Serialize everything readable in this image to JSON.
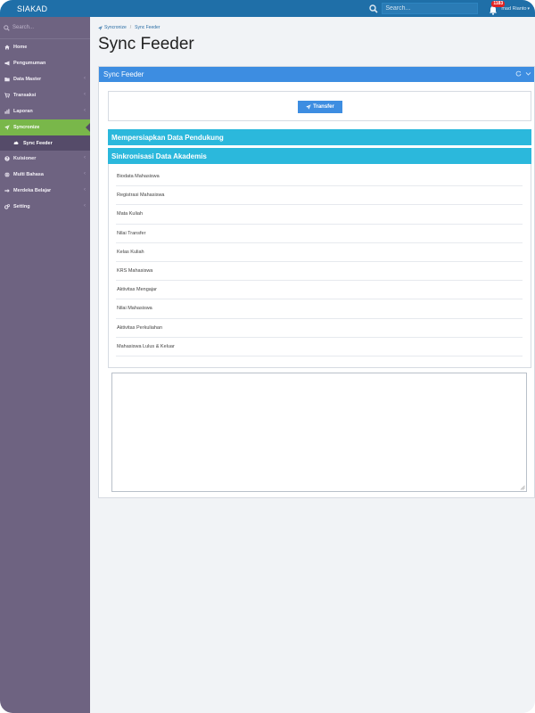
{
  "app": {
    "brand": "SIAKAD"
  },
  "topbar": {
    "search_placeholder": "Search...",
    "notification_count": "1183",
    "user_name": "mad Rianto"
  },
  "sidebar": {
    "search_text": "Search... ",
    "items": [
      {
        "label": "Home",
        "icon": "home-icon"
      },
      {
        "label": "Pengumuman",
        "icon": "bullhorn-icon"
      },
      {
        "label": "Data Master",
        "icon": "folder-icon"
      },
      {
        "label": "Transaksi",
        "icon": "cart-icon"
      },
      {
        "label": "Laporan",
        "icon": "bar-chart-icon"
      },
      {
        "label": "Syncronize",
        "icon": "paper-plane-icon"
      },
      {
        "label": "Kuisioner",
        "icon": "question-icon"
      },
      {
        "label": "Multi Bahasa",
        "icon": "globe-icon"
      },
      {
        "label": "Merdeka Belajar",
        "icon": "arrow-right-icon"
      },
      {
        "label": "Setting",
        "icon": "gears-icon"
      }
    ],
    "subitems": [
      {
        "label": "Sync Feeder",
        "icon": "cloud-icon"
      }
    ]
  },
  "breadcrumb": {
    "root": "Syncronize",
    "current": "Sync Feeder"
  },
  "page": {
    "title": "Sync Feeder"
  },
  "panel": {
    "title": "Sync Feeder",
    "transfer_label": "Transfer",
    "section_prepare": "Mempersiapkan Data Pendukung",
    "section_sync": "Sinkronisasi Data Akademis",
    "items": [
      "Biodata Mahasiswa",
      "Registrasi Mahasiswa",
      "Mata Kuliah",
      "Nilai Transfer",
      "Kelas Kuliah",
      "KRS Mahasiswa",
      "Aktivitas Mengajar",
      "Nilai Mahasiswa",
      "Aktivitas Perkuliahan",
      "Mahasiswa Lulus & Keluar"
    ]
  },
  "colors": {
    "topbar": "#1f6fa8",
    "sidebar": "#6e6381",
    "active_menu": "#79b74a",
    "panel_header": "#3d8de1",
    "section_bar": "#2bb8dc"
  }
}
